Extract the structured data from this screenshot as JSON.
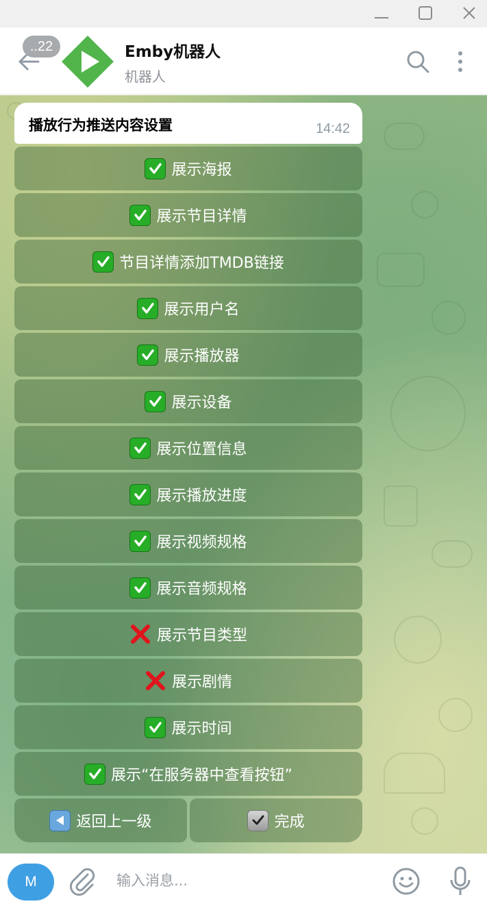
{
  "window": {
    "controls": [
      "minimize-icon",
      "maximize-icon",
      "close-icon"
    ]
  },
  "header": {
    "unread_count": "..22",
    "title": "Emby机器人",
    "subtitle": "机器人",
    "icons": [
      "back-arrow-icon",
      "search-icon",
      "more-vert-icon"
    ]
  },
  "message": {
    "text": "播放行为推送内容设置",
    "time": "14:42"
  },
  "keyboard": {
    "items": [
      {
        "label": "展示海报",
        "state": "on"
      },
      {
        "label": "展示节目详情",
        "state": "on"
      },
      {
        "label": "节目详情添加TMDB链接",
        "state": "on"
      },
      {
        "label": "展示用户名",
        "state": "on"
      },
      {
        "label": "展示播放器",
        "state": "on"
      },
      {
        "label": "展示设备",
        "state": "on"
      },
      {
        "label": "展示位置信息",
        "state": "on"
      },
      {
        "label": "展示播放进度",
        "state": "on"
      },
      {
        "label": "展示视频规格",
        "state": "on"
      },
      {
        "label": "展示音频规格",
        "state": "on"
      },
      {
        "label": "展示节目类型",
        "state": "off"
      },
      {
        "label": "展示剧情",
        "state": "off"
      },
      {
        "label": "展示时间",
        "state": "on"
      },
      {
        "label": "展示“在服务器中查看按钮”",
        "state": "on"
      }
    ],
    "back_label": "返回上一级",
    "done_label": "完成",
    "colors": {
      "check": "#27ad27",
      "cross": "#e0141c",
      "back": "#6aa7dd"
    }
  },
  "input": {
    "avatar_letter": "M",
    "placeholder": "输入消息...",
    "icons": [
      "attach-icon",
      "emoji-icon",
      "microphone-icon"
    ]
  }
}
